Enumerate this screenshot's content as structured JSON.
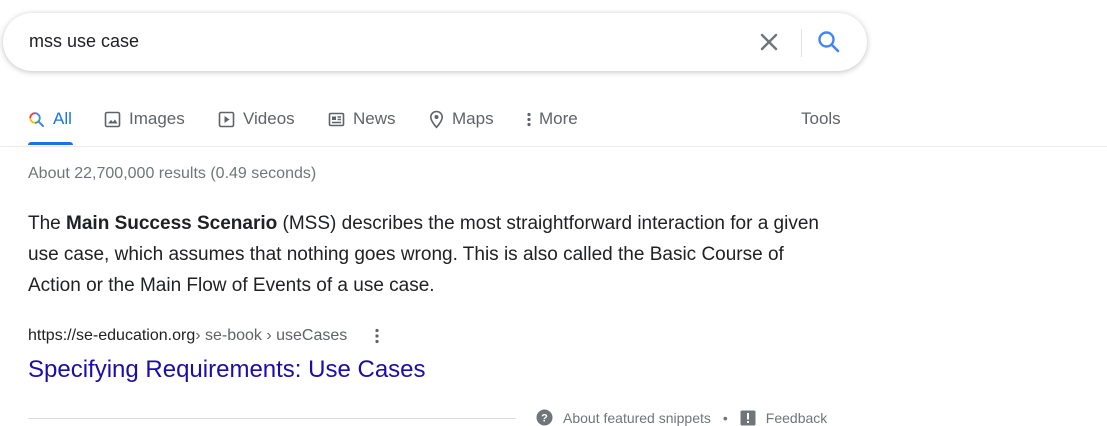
{
  "search": {
    "query": "mss use case"
  },
  "tabs": [
    {
      "label": "All",
      "icon": "search-icon",
      "active": true
    },
    {
      "label": "Images",
      "icon": "image-icon",
      "active": false
    },
    {
      "label": "Videos",
      "icon": "play-icon",
      "active": false
    },
    {
      "label": "News",
      "icon": "newspaper-icon",
      "active": false
    },
    {
      "label": "Maps",
      "icon": "map-pin-icon",
      "active": false
    },
    {
      "label": "More",
      "icon": "more-vert-icon",
      "active": false
    }
  ],
  "tools_label": "Tools",
  "result_stats": "About 22,700,000 results (0.49 seconds)",
  "featured_snippet": {
    "bold_term": "Main Success Scenario",
    "text_before": "The ",
    "text_after": " (MSS) describes the most straightforward interaction for a given use case, which assumes that nothing goes wrong. This is also called the Basic Course of Action or the Main Flow of Events of a use case.",
    "cite_domain": "https://se-education.org",
    "cite_path": " › se-book › useCases",
    "title": "Specifying Requirements: Use Cases"
  },
  "footer": {
    "about_label": "About featured snippets",
    "separator": "•",
    "feedback_label": "Feedback"
  },
  "colors": {
    "accent": "#1a73e8",
    "link": "#1a0dab",
    "muted": "#70757a"
  }
}
